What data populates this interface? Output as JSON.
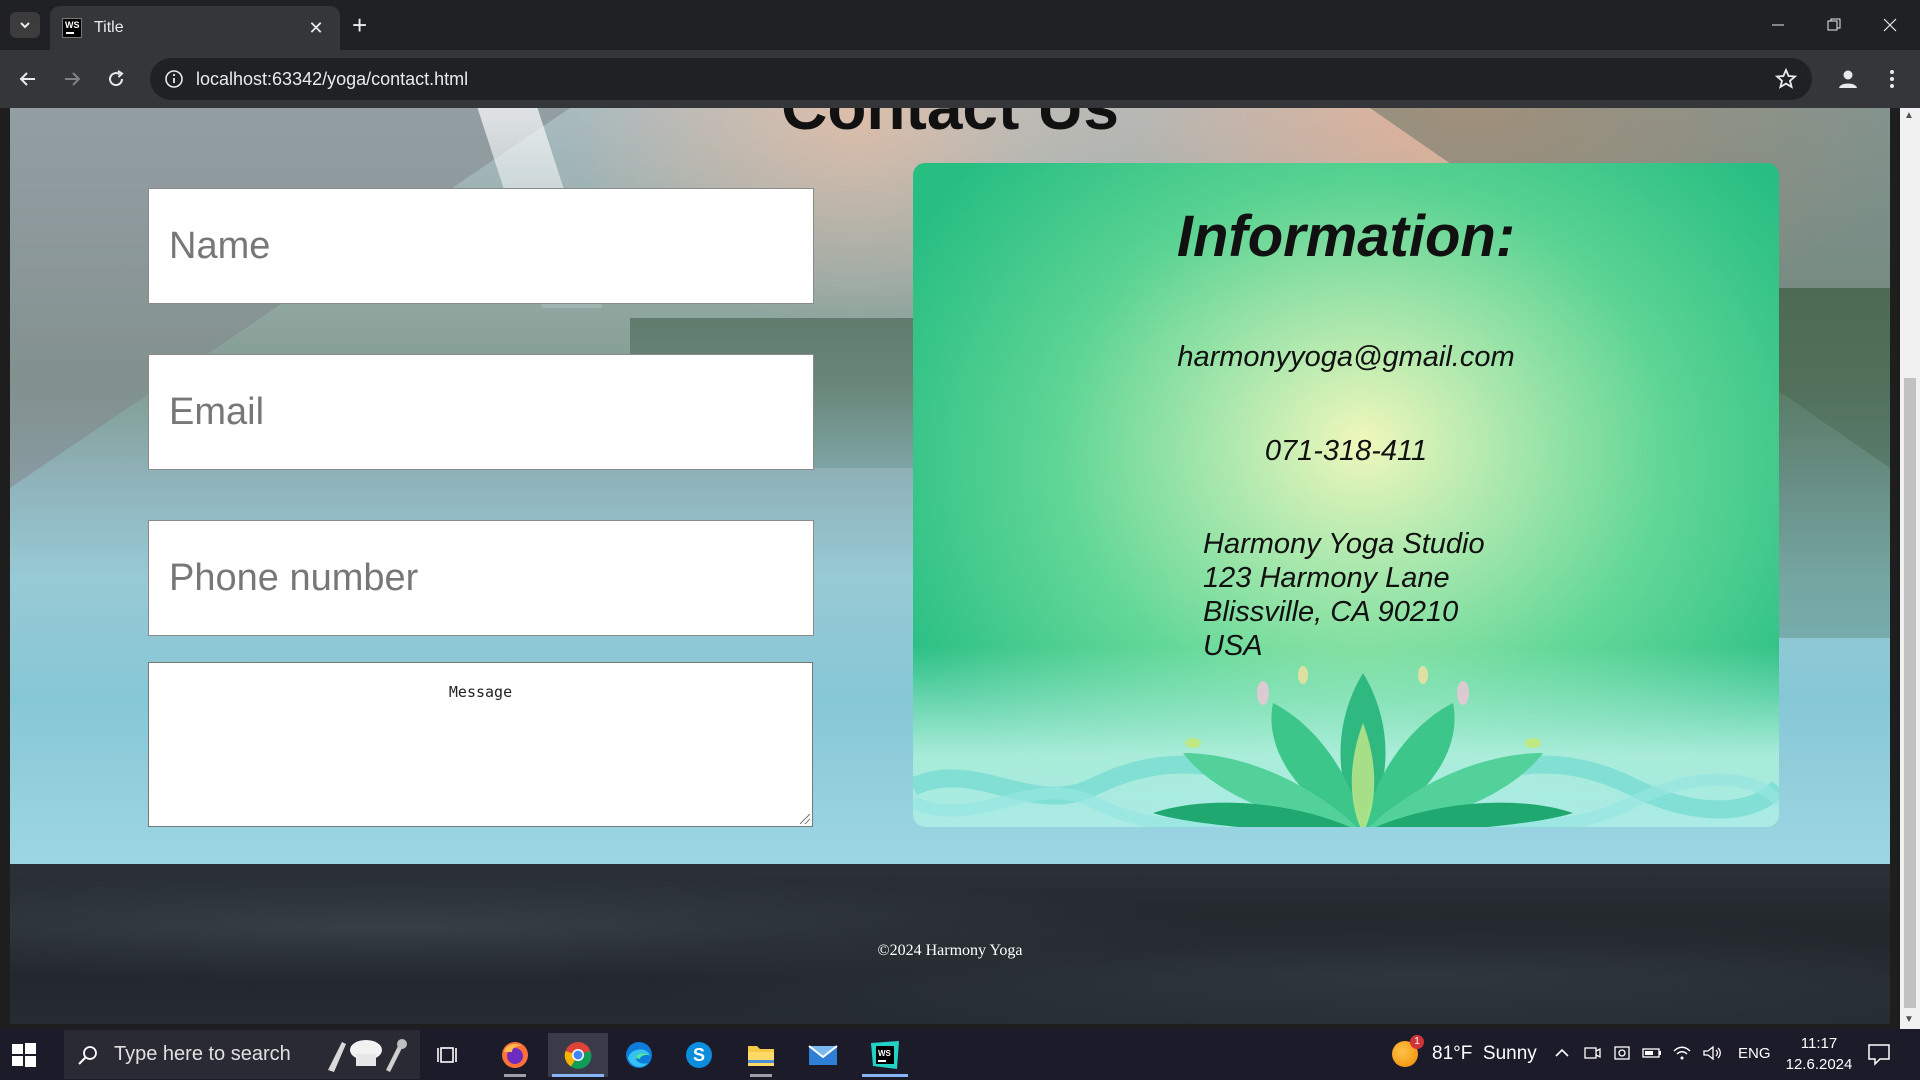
{
  "browser": {
    "tab_title": "Title",
    "tab_favicon": "WS",
    "url": "localhost:63342/yoga/contact.html"
  },
  "page": {
    "heading": "Contact Us",
    "form": {
      "name_placeholder": "Name",
      "email_placeholder": "Email",
      "phone_placeholder": "Phone number",
      "message_placeholder": "Message"
    },
    "info": {
      "title": "Information:",
      "email": "harmonyyoga@gmail.com",
      "phone": "071-318-411",
      "address": [
        "Harmony Yoga Studio",
        "123 Harmony Lane",
        "Blissville, CA 90210",
        "USA"
      ]
    },
    "footer": "©2024 Harmony Yoga"
  },
  "taskbar": {
    "search_placeholder": "Type here to search",
    "weather": "81°F  Sunny",
    "weather_badge": "1",
    "language": "ENG",
    "time": "11:17",
    "date": "12.6.2024",
    "apps": [
      "task-view",
      "firefox",
      "chrome",
      "edge",
      "skype",
      "file-explorer",
      "mail",
      "webstorm"
    ]
  },
  "colors": {
    "chrome_dark": "#202124",
    "chrome_toolbar": "#35363a",
    "info_card_green": "#1fb985",
    "taskbar": "#1b1b2a"
  }
}
